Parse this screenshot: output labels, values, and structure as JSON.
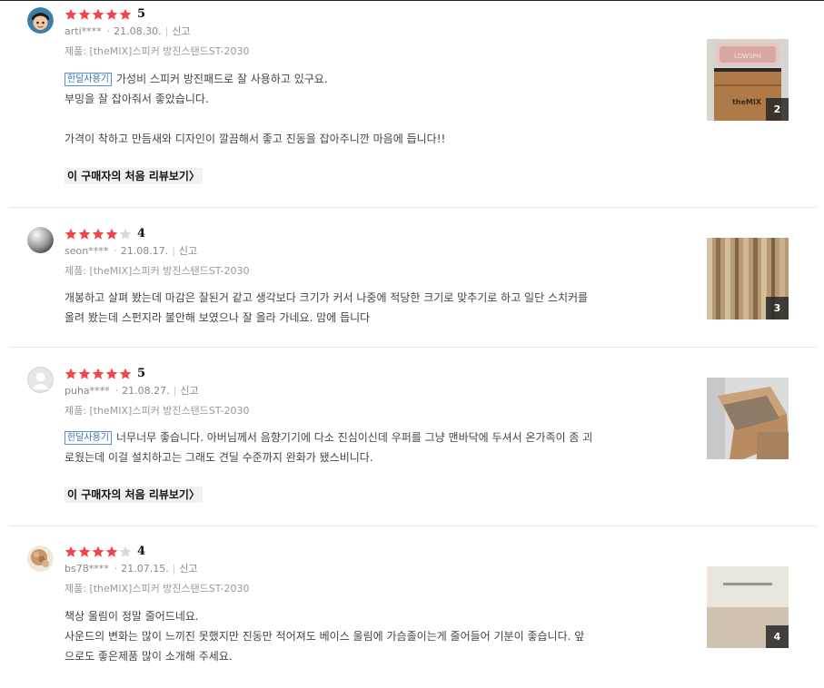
{
  "reviews": [
    {
      "rating": 5,
      "score_label": "5",
      "user": "arti****",
      "date": "21.08.30.",
      "report": "신고",
      "product": "제품: [theMIX]스피커 방진스탠드ST-2030",
      "tag": "한달사용기",
      "lines": [
        "가성비 스피커 방진패드로 잘 사용하고 있구요.",
        "부밍을 잘 잡아줘서 좋았습니다.",
        "",
        "가격이 착하고 만듬새와 디자인이 깔끔해서 좋고 진동을 잡아주니깐 마음에 듭니다!!"
      ],
      "first_review_link": "이 구매자의 처음 리뷰보기〉",
      "photo_count": "2",
      "avatar_icon": "cartoon-face-avatar",
      "photo_logo_text": "theMIX"
    },
    {
      "rating": 4,
      "score_label": "4",
      "user": "seon****",
      "date": "21.08.17.",
      "report": "신고",
      "product": "제품: [theMIX]스피커 방진스탠드ST-2030",
      "tag": "",
      "lines": [
        "개봉하고 살펴 봤는데 마감은 잘된거 같고 생각보다 크기가 커서 나중에 적당한 크기로 맞추기로 하고 일단 스치커를",
        "올려 봤는데 스펀지라 불안해 보였으나 잘 올라 가네요. 맘에 듭니다"
      ],
      "first_review_link": "",
      "photo_count": "3",
      "avatar_icon": "grey-sphere-avatar"
    },
    {
      "rating": 5,
      "score_label": "5",
      "user": "puha****",
      "date": "21.08.27.",
      "report": "신고",
      "product": "제품: [theMIX]스피커 방진스탠드ST-2030",
      "tag": "한달사용기",
      "lines": [
        "너무너무 좋습니다. 아버님께서 음향기기에 다소 진심이신데 우퍼를 그냥 맨바닥에 두셔서 온가족이 좀 괴",
        "로웠는데 이걸 설치하고는 그래도 견딜 수준까지 완화가 됐스비니다."
      ],
      "first_review_link": "이 구매자의 처음 리뷰보기〉",
      "photo_count": "",
      "avatar_icon": "default-person-avatar"
    },
    {
      "rating": 4,
      "score_label": "4",
      "user": "bs78****",
      "date": "21.07.15.",
      "report": "신고",
      "product": "제품: [theMIX]스피커 방진스탠드ST-2030",
      "tag": "",
      "lines": [
        "책상 울림이 정말 줄어드네요.",
        "사운드의 변화는 많이 느끼진 못했지만 진동만 적어져도 베이스 울림에 가슴졸이는게 줄어들어 기분이 좋습니다. 앞",
        "으로도 좋은제품 많이 소개해 주세요."
      ],
      "first_review_link": "",
      "photo_count": "4",
      "avatar_icon": "food-photo-avatar"
    }
  ],
  "colors": {
    "star_on": "#f0464b",
    "star_off": "#d9d9d9",
    "tag_border": "#5b8fd0"
  }
}
